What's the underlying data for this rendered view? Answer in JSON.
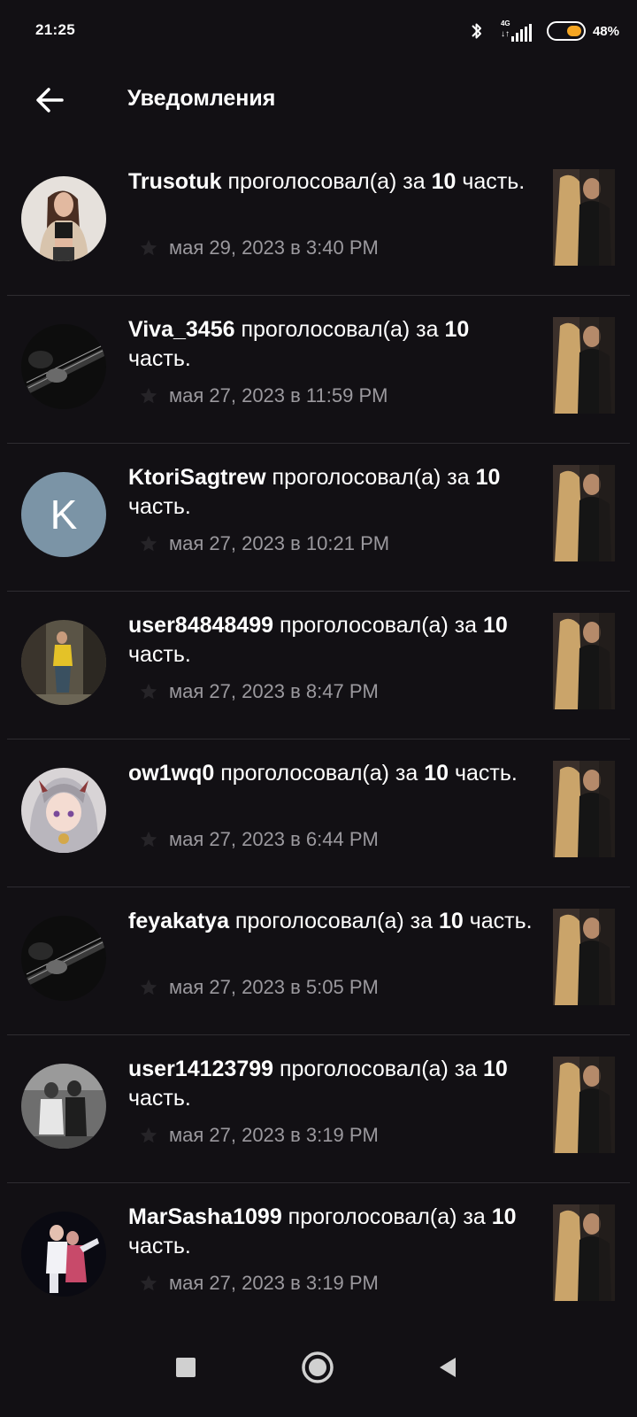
{
  "status_bar": {
    "time": "21:25",
    "network_type": "4G",
    "network_arrows": "↓↑",
    "battery_percent": "48%",
    "battery_level": 0.48,
    "icons": [
      "bluetooth-icon",
      "signal-icon",
      "battery-icon"
    ]
  },
  "header": {
    "title": "Уведомления",
    "back_icon": "arrow-left-icon"
  },
  "notifications": [
    {
      "username": "Trusotuk",
      "action": " проголосовал(а) за ",
      "chapter": "10",
      "suffix": " часть.",
      "timestamp": "мая 29, 2023 в 3:40 PM"
    },
    {
      "username": "Viva_3456",
      "action": " проголосовал(а) за ",
      "chapter": "10",
      "suffix": " часть.",
      "timestamp": "мая 27, 2023 в 11:59 PM"
    },
    {
      "username": "KtoriSagtrew",
      "action": " проголосовал(а) за ",
      "chapter": "10",
      "suffix": " часть.",
      "timestamp": "мая 27, 2023 в 10:21 PM",
      "avatar_letter": "K"
    },
    {
      "username": "user84848499",
      "action": " проголосовал(а) за ",
      "chapter": "10",
      "suffix": " часть.",
      "timestamp": "мая 27, 2023 в 8:47 PM"
    },
    {
      "username": "ow1wq0",
      "action": " проголосовал(а) за ",
      "chapter": "10",
      "suffix": " часть.",
      "timestamp": "мая 27, 2023 в 6:44 PM"
    },
    {
      "username": "feyakatya",
      "action": " проголосовал(а) за ",
      "chapter": "10",
      "suffix": " часть.",
      "timestamp": "мая 27, 2023 в 5:05 PM"
    },
    {
      "username": "user14123799",
      "action": " проголосовал(а) за ",
      "chapter": "10",
      "suffix": " часть.",
      "timestamp": "мая 27, 2023 в 3:19 PM"
    },
    {
      "username": "MarSasha1099",
      "action": " проголосовал(а) за ",
      "chapter": "10",
      "suffix": " часть.",
      "timestamp": "мая 27, 2023 в 3:19 PM"
    }
  ],
  "nav_bar": {
    "icons": [
      "recents-square-icon",
      "home-circle-icon",
      "back-triangle-icon"
    ]
  },
  "colors": {
    "background": "#121014",
    "text_primary": "#ffffff",
    "text_secondary": "#9b999e",
    "divider": "#2e2c31",
    "battery_accent": "#f5a623",
    "letter_avatar_bg": "#7b94a6"
  }
}
